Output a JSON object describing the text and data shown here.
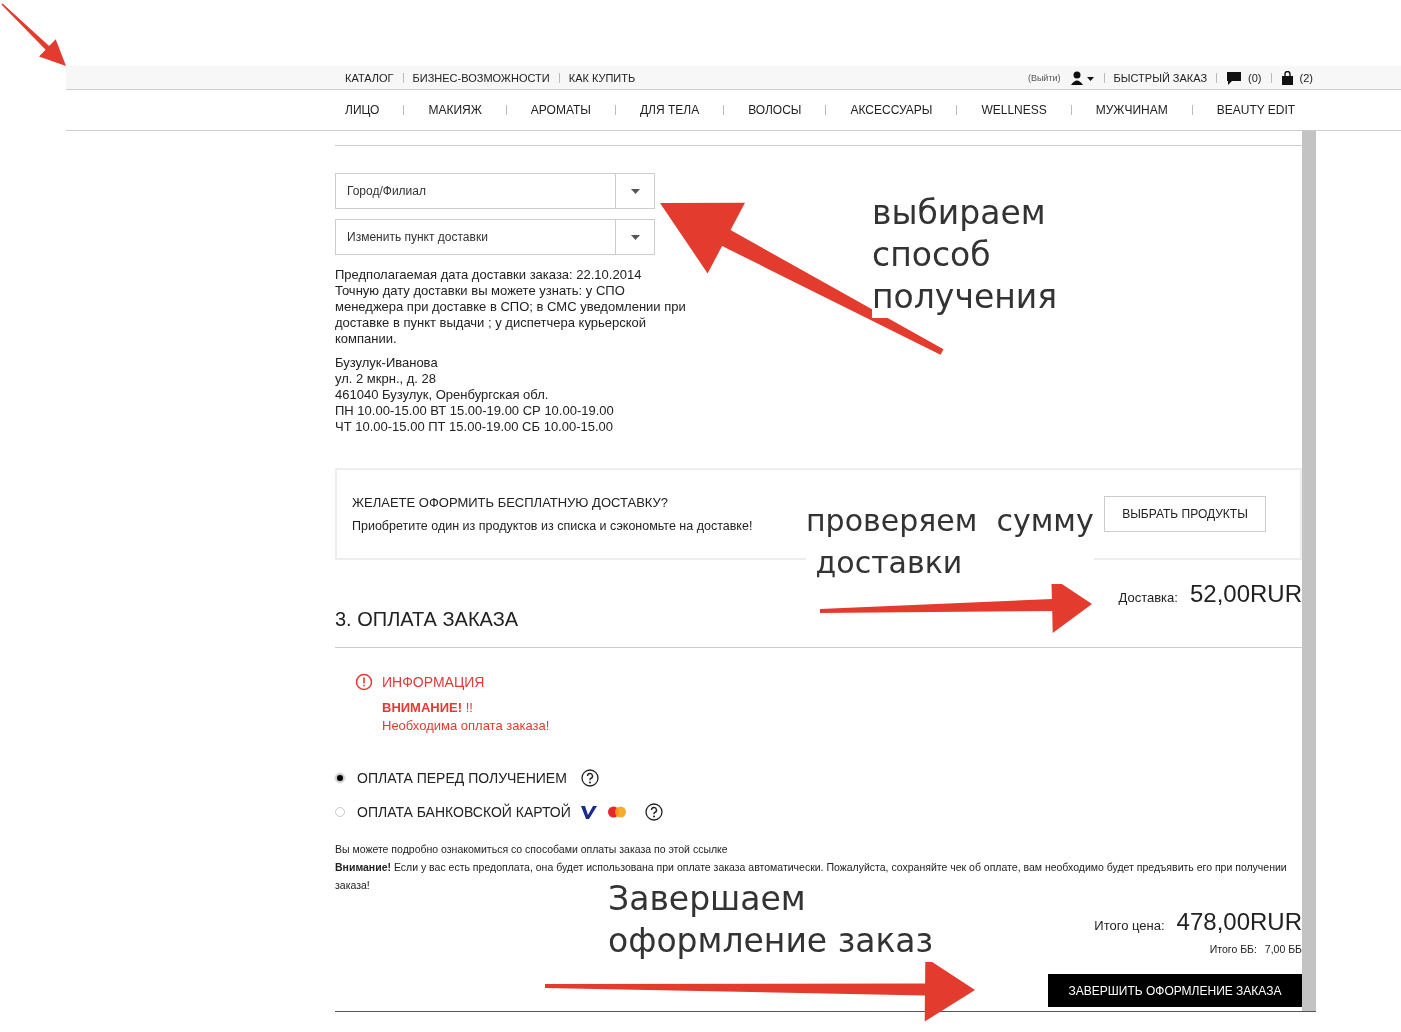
{
  "top_links": [
    "КАТАЛОГ",
    "БИЗНЕС-ВОЗМОЖНОСТИ",
    "КАК КУПИТЬ"
  ],
  "account": {
    "logout": "(Выйти)",
    "quick_order": "БЫСТРЫЙ ЗАКАЗ",
    "messages_count": "(0)",
    "cart_count": "(2)"
  },
  "nav": [
    "ЛИЦО",
    "МАКИЯЖ",
    "АРОМАТЫ",
    "ДЛЯ ТЕЛА",
    "ВОЛОСЫ",
    "АКСЕССУАРЫ",
    "WELLNESS",
    "МУЖЧИНАМ",
    "BEAUTY EDIT"
  ],
  "delivery": {
    "selects": [
      {
        "placeholder": "Город/Филиал"
      },
      {
        "placeholder": "Изменить пункт доставки"
      }
    ],
    "date_note": "Предполагаемая дата доставки заказа: 22.10.2014",
    "info": "Точную дату доставки вы можете узнать: у СПО менеджера при доставке в СПО; в СМС уведомлении при доставке в пункт выдачи ; у диспетчера курьерской компании.",
    "address_lines": [
      "Бузулук-Иванова",
      "ул. 2 мкрн., д. 28",
      "461040 Бузулук, Оренбургская обл.",
      "ПН 10.00-15.00 ВТ 15.00-19.00 СР 10.00-19.00",
      "ЧТ 10.00-15.00 ПТ 15.00-19.00 СБ 10.00-15.00"
    ]
  },
  "free_delivery": {
    "title": "ЖЕЛАЕТЕ ОФОРМИТЬ БЕСПЛАТНУЮ ДОСТАВКУ?",
    "text": "Приобретите один из продуктов из списка и сэкономьте на доставке!",
    "button": "ВЫБРАТЬ ПРОДУКТЫ"
  },
  "delivery_cost": {
    "label": "Доставка:",
    "value": "52,00RUR"
  },
  "payment": {
    "heading": "3. ОПЛАТА ЗАКАЗА",
    "alert": {
      "title": "ИНФОРМАЦИЯ",
      "warning": "**ВНИМАНИЕ!** !!",
      "message": "Необходима оплата заказа!"
    },
    "methods": [
      {
        "label": "ОПЛАТА ПЕРЕД ПОЛУЧЕНИЕМ",
        "selected": true,
        "kind": "plain"
      },
      {
        "label": "ОПЛАТА БАНКОВСКОЙ КАРТОЙ",
        "selected": false,
        "kind": "card"
      }
    ],
    "note": "Вы можете подробно ознакомиться со способами оплаты заказа по этой ссылке",
    "notice": "**Внимание!** Если у вас есть предоплата, она будет использована при оплате заказа автоматически. Пожалуйста, сохраняйте чек об оплате, вам необходимо будет предъявить его при получении заказа!"
  },
  "totals": {
    "price_label": "Итого цена:",
    "price": "478,00RUR",
    "bb_label": "Итого ББ:",
    "bb": "7,00 ББ"
  },
  "submit_button": "ЗАВЕРШИТЬ ОФОРМЛЕНИЕ ЗАКАЗА",
  "annotations": [
    {
      "lines": [
        "выбираем",
        "способ",
        "получения"
      ]
    },
    {
      "lines": [
        "проверяем  сумму",
        " доставки"
      ]
    },
    {
      "lines": [
        "Завершаем",
        "оформление заказ"
      ]
    }
  ]
}
